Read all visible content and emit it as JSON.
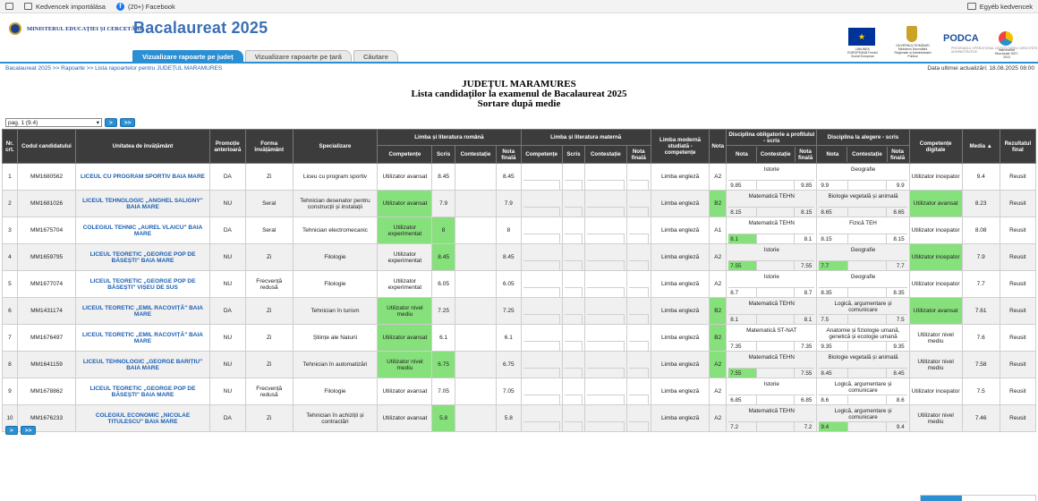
{
  "bookmarks": {
    "items": [
      {
        "label": "Kedvencek importálása",
        "icon": "import-icon"
      },
      {
        "label": "(20+) Facebook",
        "icon": "facebook-icon"
      }
    ],
    "other_label": "Egyéb kedvencek"
  },
  "header": {
    "ministry": "MINISTERUL EDUCAȚIEI ȘI CERCETĂRII",
    "title": "Bacalaureat 2025",
    "tabs": [
      {
        "label": "Vizualizare rapoarte pe județ",
        "active": true
      },
      {
        "label": "Vizualizare rapoarte pe țară",
        "active": false
      },
      {
        "label": "Căutare",
        "active": false
      }
    ],
    "logos": {
      "eu_text": "UNIUNEA EUROPEANĂ Fondul Social European",
      "gov_text": "GUVERNUL ROMÂNIEI Ministerul Dezvoltării Regionale și Administrației Publice",
      "podca": "PODCA",
      "podca_sub": "PROGRAMUL OPERAȚIONAL DEZVOLTAREA CAPACITĂȚII ADMINISTRATIVE",
      "right_text": "Instrumente Structurale 2007-2013"
    }
  },
  "breadcrumb": "Bacalaureat 2025 >> Rapoarte >> Lista rapoartelor pentru JUDEȚUL MARAMURES",
  "last_update": "Data ultimei actualizări: 18.08.2025 08:00",
  "titles": {
    "line1": "JUDEȚUL MARAMURES",
    "line2": "Lista candidaților la examenul de Bacalaureat 2025",
    "line3": "Sortare după medie"
  },
  "pager": {
    "select_value": "pag. 1 (9.4)",
    "next": ">",
    "last": ">>"
  },
  "table": {
    "headers": {
      "nr": "Nr. crt.",
      "code": "Codul candidatului",
      "school": "Unitatea de învățământ",
      "promo": "Promoție anterioară",
      "form": "Forma învățământ",
      "spec": "Specializare",
      "lrom": "Limba și literatura română",
      "lmat": "Limba și literatura maternă",
      "lmod": "Limba modernă studiată - competențe",
      "nota": "Nota",
      "dobl": "Disciplina obligatorie a profilului - scris",
      "dalg": "Disciplina la alegere - scris",
      "dig": "Competențe digitale",
      "media": "Media ▲",
      "rez": "Rezultatul final",
      "sub_comp": "Competențe",
      "sub_scris": "Scris",
      "sub_cont": "Contestație",
      "sub_final": "Nota finală",
      "sub_nota": "Nota"
    },
    "rows": [
      {
        "nr": "1",
        "code": "MM1680562",
        "school": "LICEUL CU PROGRAM SPORTIV BAIA MARE",
        "promo": "DA",
        "form": "Zi",
        "spec": "Liceu cu program sportiv",
        "rom_comp": "Utilizator avansat",
        "rom_scris": "8.45",
        "rom_final": "8.45",
        "lmod": "Limba engleză",
        "lmod_nota": "A2",
        "obl_name": "Istorie",
        "obl_nota": "9.85",
        "obl_final": "9.85",
        "alg_name": "Geografie",
        "alg_nota": "9.9",
        "alg_final": "9.9",
        "dig": "Utilizator incepator",
        "media": "9.4",
        "rez": "Reusit"
      },
      {
        "nr": "2",
        "code": "MM1681026",
        "school": "LICEUL TEHNOLOGIC „ANGHEL SALIGNY\" BAIA MARE",
        "promo": "NU",
        "form": "Seral",
        "spec": "Tehnician desenator pentru construcții și instalații",
        "rom_comp": "Utilizator avansat",
        "rom_scris": "7.9",
        "rom_final": "7.9",
        "lmod": "Limba engleză",
        "lmod_nota": "B2",
        "obl_name": "Matematică TEHN",
        "obl_nota": "8.15",
        "obl_final": "8.15",
        "alg_name": "Biologie vegetală și animală",
        "alg_nota": "8.65",
        "alg_final": "8.65",
        "dig": "Utilizator avansat",
        "media": "8.23",
        "rez": "Reusit"
      },
      {
        "nr": "3",
        "code": "MM1675704",
        "school": "COLEGIUL TEHNIC „AUREL VLAICU\" BAIA MARE",
        "promo": "DA",
        "form": "Seral",
        "spec": "Tehnician electromecanic",
        "rom_comp": "Utilizator experimentat",
        "rom_scris": "8",
        "rom_final": "8",
        "lmod": "Limba engleză",
        "lmod_nota": "A1",
        "obl_name": "Matematică TEHN",
        "obl_nota": "8.1",
        "obl_final": "8.1",
        "alg_name": "Fizică TEH",
        "alg_nota": "8.15",
        "alg_final": "8.15",
        "dig": "Utilizator incepator",
        "media": "8.08",
        "rez": "Reusit"
      },
      {
        "nr": "4",
        "code": "MM1659795",
        "school": "LICEUL TEORETIC „GEORGE POP DE BĂSEȘTI\" BAIA MARE",
        "promo": "NU",
        "form": "Zi",
        "spec": "Filologie",
        "rom_comp": "Utilizator experimentat",
        "rom_scris": "8.45",
        "rom_final": "8.45",
        "lmod": "Limba engleză",
        "lmod_nota": "A2",
        "obl_name": "Istorie",
        "obl_nota": "7.55",
        "obl_final": "7.55",
        "alg_name": "Geografie",
        "alg_nota": "7.7",
        "alg_final": "7.7",
        "dig": "Utilizator incepator",
        "media": "7.9",
        "rez": "Reusit"
      },
      {
        "nr": "5",
        "code": "MM1677074",
        "school": "LICEUL TEORETIC „GEORGE POP DE BĂSEȘTI\" VIȘEU DE SUS",
        "promo": "NU",
        "form": "Frecvență redusă",
        "spec": "Filologie",
        "rom_comp": "Utilizator experimentat",
        "rom_scris": "6.05",
        "rom_final": "6.05",
        "lmod": "Limba engleză",
        "lmod_nota": "A2",
        "obl_name": "Istorie",
        "obl_nota": "8.7",
        "obl_final": "8.7",
        "alg_name": "Geografie",
        "alg_nota": "8.35",
        "alg_final": "8.35",
        "dig": "Utilizator incepator",
        "media": "7.7",
        "rez": "Reusit"
      },
      {
        "nr": "6",
        "code": "MM1431174",
        "school": "LICEUL TEORETIC „EMIL RACOVIȚĂ\" BAIA MARE",
        "promo": "DA",
        "form": "Zi",
        "spec": "Tehnician în turism",
        "rom_comp": "Utilizator nivel mediu",
        "rom_scris": "7.25",
        "rom_final": "7.25",
        "lmod": "Limba engleză",
        "lmod_nota": "B2",
        "obl_name": "Matematică TEHN",
        "obl_nota": "8.1",
        "obl_final": "8.1",
        "alg_name": "Logică, argumentare și comunicare",
        "alg_nota": "7.5",
        "alg_final": "7.5",
        "dig": "Utilizator avansat",
        "media": "7.61",
        "rez": "Reusit"
      },
      {
        "nr": "7",
        "code": "MM1676497",
        "school": "LICEUL TEORETIC „EMIL RACOVIȚĂ\" BAIA MARE",
        "promo": "NU",
        "form": "Zi",
        "spec": "Științe ale Naturii",
        "rom_comp": "Utilizator avansat",
        "rom_scris": "6.1",
        "rom_final": "6.1",
        "lmod": "Limba engleză",
        "lmod_nota": "B2",
        "obl_name": "Matematică ST-NAT",
        "obl_nota": "7.35",
        "obl_final": "7.35",
        "alg_name": "Anatomie și fiziologie umană, genetică și ecologie umană",
        "alg_nota": "9.35",
        "alg_final": "9.35",
        "dig": "Utilizator nivel mediu",
        "media": "7.6",
        "rez": "Reusit"
      },
      {
        "nr": "8",
        "code": "MM1641159",
        "school": "LICEUL TEHNOLOGIC „GEORGE BARIȚIU\" BAIA MARE",
        "promo": "NU",
        "form": "Zi",
        "spec": "Tehnician în automatizări",
        "rom_comp": "Utilizator nivel mediu",
        "rom_scris": "6.75",
        "rom_final": "6.75",
        "lmod": "Limba engleză",
        "lmod_nota": "A2",
        "obl_name": "Matematică TEHN",
        "obl_nota": "7.55",
        "obl_final": "7.55",
        "alg_name": "Biologie vegetală și animală",
        "alg_nota": "8.45",
        "alg_final": "8.45",
        "dig": "Utilizator nivel mediu",
        "media": "7.58",
        "rez": "Reusit"
      },
      {
        "nr": "9",
        "code": "MM1678862",
        "school": "LICEUL TEORETIC „GEORGE POP DE BĂSEȘTI\" BAIA MARE",
        "promo": "NU",
        "form": "Frecvență redusă",
        "spec": "Filologie",
        "rom_comp": "Utilizator avansat",
        "rom_scris": "7.05",
        "rom_final": "7.05",
        "lmod": "Limba engleză",
        "lmod_nota": "A2",
        "obl_name": "Istorie",
        "obl_nota": "6.85",
        "obl_final": "6.85",
        "alg_name": "Logică, argumentare și comunicare",
        "alg_nota": "8.6",
        "alg_final": "8.6",
        "dig": "Utilizator incepator",
        "media": "7.5",
        "rez": "Reusit"
      },
      {
        "nr": "10",
        "code": "MM1676233",
        "school": "COLEGIUL ECONOMIC „NICOLAE TITULESCU\" BAIA MARE",
        "promo": "DA",
        "form": "Zi",
        "spec": "Tehnician în achiziții și contractări",
        "rom_comp": "Utilizator avansat",
        "rom_scris": "5.8",
        "rom_final": "5.8",
        "lmod": "Limba engleză",
        "lmod_nota": "A2",
        "obl_name": "Matematică TEHN",
        "obl_nota": "7.2",
        "obl_final": "7.2",
        "alg_name": "Logică, argumentare și comunicare",
        "alg_nota": "9.4",
        "alg_final": "9.4",
        "dig": "Utilizator nivel mediu",
        "media": "7.46",
        "rez": "Reusit"
      }
    ]
  },
  "highlight_color": "#86e07b",
  "accent_color": "#2a8fd3"
}
